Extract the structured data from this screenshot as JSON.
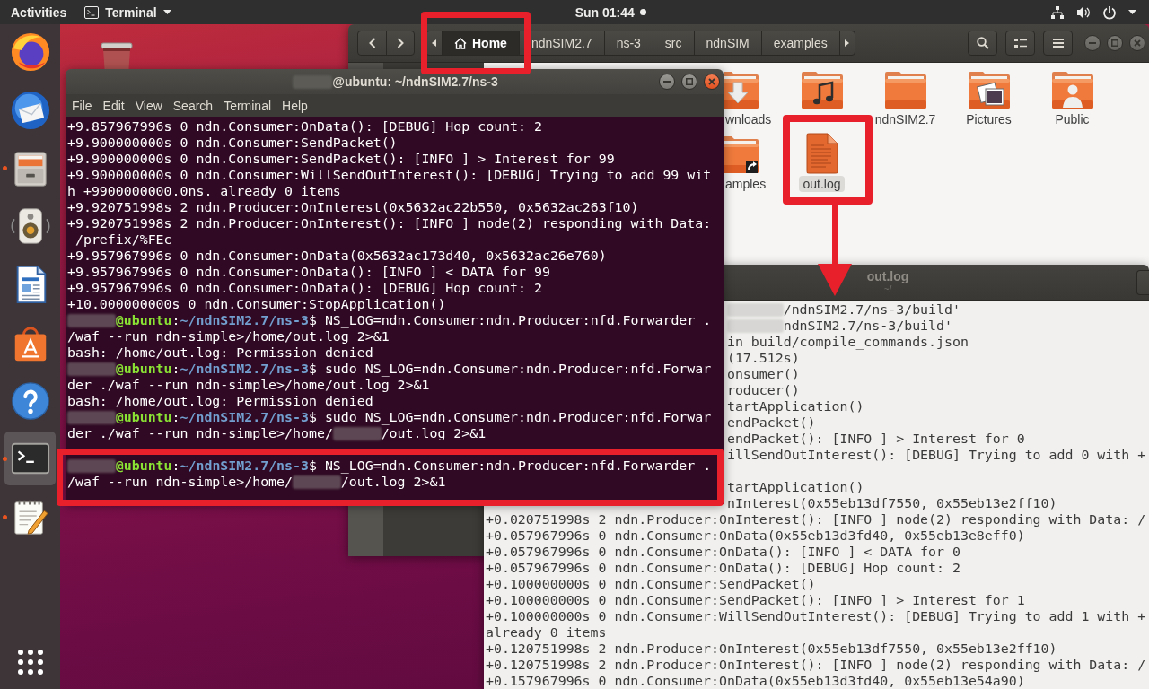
{
  "top_bar": {
    "activities": "Activities",
    "app_menu": "Terminal",
    "clock": "Sun 01:44",
    "notifications": true
  },
  "dock": {
    "items": [
      {
        "kind": "browser",
        "running": false,
        "selected": false
      },
      {
        "kind": "mail",
        "running": false,
        "selected": false
      },
      {
        "kind": "files",
        "running": true,
        "selected": false
      },
      {
        "kind": "music",
        "running": false,
        "selected": false
      },
      {
        "kind": "writer",
        "running": false,
        "selected": false
      },
      {
        "kind": "store",
        "running": false,
        "selected": false
      },
      {
        "kind": "help",
        "running": false,
        "selected": false
      },
      {
        "kind": "terminal",
        "running": true,
        "selected": true
      },
      {
        "kind": "editor",
        "running": true,
        "selected": false
      }
    ]
  },
  "file_manager": {
    "focused": false,
    "path": [
      {
        "kind": "home",
        "label": "Home",
        "selected": true
      },
      {
        "kind": "folder",
        "label": "ndnSIM2.7",
        "selected": false
      },
      {
        "kind": "folder",
        "label": "ns-3",
        "selected": false
      },
      {
        "kind": "folder",
        "label": "src",
        "selected": false
      },
      {
        "kind": "folder",
        "label": "ndnSIM",
        "selected": false
      },
      {
        "kind": "folder",
        "label": "examples",
        "selected": false
      }
    ],
    "files": [
      {
        "kind": "downloads",
        "name": "wnloads",
        "selected": false
      },
      {
        "kind": "music",
        "selected": false
      },
      {
        "kind": "folder",
        "name": "ndnSIM2.7",
        "selected": false
      },
      {
        "kind": "pictures",
        "name": "Pictures",
        "selected": false
      },
      {
        "kind": "public",
        "name": "Public",
        "selected": false
      },
      {
        "kind": "link",
        "name": "amples",
        "selected": false
      },
      {
        "kind": "text",
        "name": "out.log",
        "selected": true
      }
    ]
  },
  "log_window": {
    "focused": false,
    "title": "out.log",
    "subtitle": "~/",
    "lines": [
      {
        "segments": [
          {
            "kind": "redacted"
          },
          {
            "kind": "plain",
            "text": "/ndnSIM2.7/ns-3/build'"
          }
        ]
      },
      {
        "segments": [
          {
            "kind": "redacted"
          },
          {
            "kind": "plain",
            "text": "ndnSIM2.7/ns-3/build'"
          }
        ]
      },
      {
        "text": "in build/compile_commands.json"
      },
      {
        "text": "(17.512s)"
      },
      {
        "text": "onsumer()"
      },
      {
        "text": "roducer()"
      },
      {
        "text": "tartApplication()"
      },
      {
        "text": "endPacket()"
      },
      {
        "text": "endPacket(): [INFO ] > Interest for 0"
      },
      {
        "text": "illSendOutInterest(): [DEBUG] Trying to add 0 with +"
      },
      {
        "text": "tartApplication()"
      },
      {
        "text": "nInterest(0x55eb13df7550, 0x55eb13e2ff10)"
      },
      {
        "text": "+0.020751998s 2 ndn.Producer:OnInterest(): [INFO ] node(2) responding with Data: /"
      },
      {
        "text": "+0.057967996s 0 ndn.Consumer:OnData(0x55eb13d3fd40, 0x55eb13e8eff0)"
      },
      {
        "text": "+0.057967996s 0 ndn.Consumer:OnData(): [INFO ] < DATA for 0"
      },
      {
        "text": "+0.057967996s 0 ndn.Consumer:OnData(): [DEBUG] Hop count: 2"
      },
      {
        "text": "+0.100000000s 0 ndn.Consumer:SendPacket()"
      },
      {
        "text": "+0.100000000s 0 ndn.Consumer:SendPacket(): [INFO ] > Interest for 1"
      },
      {
        "text": "+0.100000000s 0 ndn.Consumer:WillSendOutInterest(): [DEBUG] Trying to add 1 with +"
      },
      {
        "text": "already 0 items"
      },
      {
        "text": "+0.120751998s 2 ndn.Producer:OnInterest(0x55eb13df7550, 0x55eb13e2ff10)"
      },
      {
        "text": "+0.120751998s 2 ndn.Producer:OnInterest(): [INFO ] node(2) responding with Data: /"
      },
      {
        "text": "+0.157967996s 0 ndn.Consumer:OnData(0x55eb13d3fd40, 0x55eb13e54a90)"
      }
    ]
  },
  "terminal": {
    "focused": true,
    "title": {
      "segments": [
        {
          "kind": "redacted"
        },
        {
          "kind": "plain",
          "text": "@ubuntu: ~/ndnSIM2.7/ns-3"
        }
      ]
    },
    "menu": [
      "File",
      "Edit",
      "View",
      "Search",
      "Terminal",
      "Help"
    ],
    "lines": [
      {
        "text": "+9.857967996s 0 ndn.Consumer:OnData(): [DEBUG] Hop count: 2"
      },
      {
        "text": "+9.900000000s 0 ndn.Consumer:SendPacket()"
      },
      {
        "text": "+9.900000000s 0 ndn.Consumer:SendPacket(): [INFO ] > Interest for 99"
      },
      {
        "text": "+9.900000000s 0 ndn.Consumer:WillSendOutInterest(): [DEBUG] Trying to add 99 wit"
      },
      {
        "text": "h +9900000000.0ns. already 0 items"
      },
      {
        "text": "+9.920751998s 2 ndn.Producer:OnInterest(0x5632ac22b550, 0x5632ac263f10)"
      },
      {
        "text": "+9.920751998s 2 ndn.Producer:OnInterest(): [INFO ] node(2) responding with Data:"
      },
      {
        "text": " /prefix/%FEc"
      },
      {
        "text": "+9.957967996s 0 ndn.Consumer:OnData(0x5632ac173d40, 0x5632ac26e760)"
      },
      {
        "text": "+9.957967996s 0 ndn.Consumer:OnData(): [INFO ] < DATA for 99"
      },
      {
        "text": "+9.957967996s 0 ndn.Consumer:OnData(): [DEBUG] Hop count: 2"
      },
      {
        "text": "+10.000000000s 0 ndn.Consumer:StopApplication()"
      },
      {
        "segments": [
          {
            "kind": "redacted"
          },
          {
            "kind": "host",
            "text": "@ubuntu"
          },
          {
            "kind": "plain",
            "text": ":"
          },
          {
            "kind": "path",
            "text": "~/ndnSIM2.7/ns-3"
          },
          {
            "kind": "plain",
            "text": "$ NS_LOG=ndn.Consumer:ndn.Producer:nfd.Forwarder ."
          }
        ]
      },
      {
        "text": "/waf --run ndn-simple>/home/out.log 2>&1"
      },
      {
        "text": "bash: /home/out.log: Permission denied"
      },
      {
        "segments": [
          {
            "kind": "redacted"
          },
          {
            "kind": "host",
            "text": "@ubuntu"
          },
          {
            "kind": "plain",
            "text": ":"
          },
          {
            "kind": "path",
            "text": "~/ndnSIM2.7/ns-3"
          },
          {
            "kind": "plain",
            "text": "$ sudo NS_LOG=ndn.Consumer:ndn.Producer:nfd.Forwar"
          }
        ]
      },
      {
        "text": "der ./waf --run ndn-simple>/home/out.log 2>&1"
      },
      {
        "text": "bash: /home/out.log: Permission denied"
      },
      {
        "segments": [
          {
            "kind": "redacted"
          },
          {
            "kind": "host",
            "text": "@ubuntu"
          },
          {
            "kind": "plain",
            "text": ":"
          },
          {
            "kind": "path",
            "text": "~/ndnSIM2.7/ns-3"
          },
          {
            "kind": "plain",
            "text": "$ sudo NS_LOG=ndn.Consumer:ndn.Producer:nfd.Forwar"
          }
        ]
      },
      {
        "segments": [
          {
            "kind": "plain",
            "text": "der ./waf --run ndn-simple>/home/"
          },
          {
            "kind": "redacted"
          },
          {
            "kind": "plain",
            "text": "/out.log 2>&1"
          }
        ]
      },
      {
        "segments": [
          {
            "kind": "redacted"
          },
          {
            "kind": "host",
            "text": "@ubuntu"
          },
          {
            "kind": "plain",
            "text": ":"
          },
          {
            "kind": "path",
            "text": "~/ndnSIM2.7/ns-3"
          },
          {
            "kind": "plain",
            "text": "$ NS_LOG=ndn.Consumer:ndn.Producer:nfd.Forwarder ."
          }
        ]
      },
      {
        "segments": [
          {
            "kind": "plain",
            "text": "/waf --run ndn-simple>/home/"
          },
          {
            "kind": "redacted"
          },
          {
            "kind": "plain",
            "text": "/out.log 2>&1"
          }
        ]
      }
    ]
  }
}
